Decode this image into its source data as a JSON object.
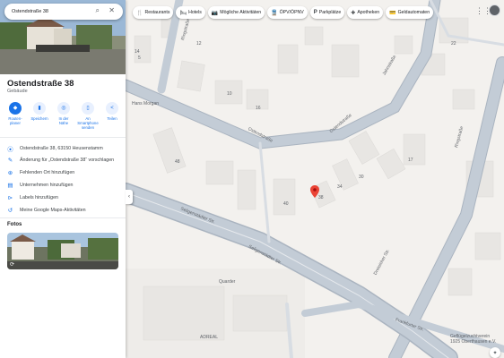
{
  "search": {
    "value": "Ostendstraße 38"
  },
  "place": {
    "title": "Ostendstraße 38",
    "category": "Gebäude"
  },
  "actions": [
    {
      "label": "Routen-\nplaner",
      "icon": "directions-icon"
    },
    {
      "label": "Speichern",
      "icon": "bookmark-icon"
    },
    {
      "label": "In der Nähe",
      "icon": "nearby-icon"
    },
    {
      "label": "An Smartphone senden",
      "icon": "phone-icon"
    },
    {
      "label": "Teilen",
      "icon": "share-icon"
    }
  ],
  "info": {
    "address": "Ostendstraße 38, 63150 Heusenstamm",
    "suggest_edit": "Änderung für „Ostendstraße 38“ vorschlagen",
    "add_place": "Fehlenden Ort hinzufügen",
    "add_business": "Unternehmen hinzufügen",
    "add_label": "Labels hinzufügen",
    "activity": "Meine Google Maps-Aktivitäten"
  },
  "photos_title": "Fotos",
  "chips": [
    "Restaurants",
    "Hotels",
    "Mögliche Aktivitäten",
    "ÖPV/ÖPNV",
    "Parkplätze",
    "Apotheken",
    "Geldautomaten"
  ],
  "map_labels": {
    "ostendstrasse": "Ostendstraße",
    "ostendstrasse2": "Ostendstraße",
    "hans_morgan": "Hans Morgan",
    "ringstrasse1": "Ringstraße",
    "ringstrasse2": "Ringstraße",
    "jahnstrasse": "Jahnstraße",
    "seligenstaedter1": "Seligenstädter Str.",
    "seligenstaedter2": "Seligenstädter Str.",
    "dreieich": "Dreieicher Str.",
    "frankfurter": "Frankfurter Str.",
    "poi_quarder": "Quarder",
    "poi_adreal": "ADREAL",
    "poi_gefluegel": "Geflügelzuchtverein",
    "poi_gefluegel2": "1925 Oberthausen e.V.",
    "num_48": "48",
    "num_40": "40",
    "num_38": "38",
    "num_34": "34",
    "num_30": "30",
    "num_12": "12",
    "num_10": "10",
    "num_16": "16",
    "num_14": "14",
    "num_5": "5",
    "num_22": "22",
    "num_17": "17"
  }
}
